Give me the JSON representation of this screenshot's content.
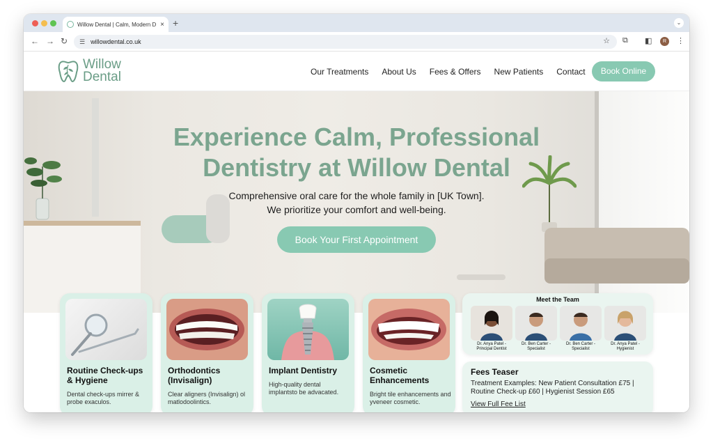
{
  "browser": {
    "tab_title": "Willow Dental | Calm, Modern D",
    "new_tab": "+",
    "close_tab": "×",
    "url": "willowdental.co.uk",
    "profile_initial": "R"
  },
  "site": {
    "logo_line1": "Willow",
    "logo_line2": "Dental",
    "nav": [
      "Our Treatments",
      "About Us",
      "Fees & Offers",
      "New Patients",
      "Contact"
    ],
    "book_online": "Book Online"
  },
  "hero": {
    "title_line1": "Experience Calm, Professional",
    "title_line2": "Dentistry at Willow Dental",
    "subtitle_line1": "Comprehensive oral care for the whole family in [UK Town].",
    "subtitle_line2": "We prioritize your comfort and well-being.",
    "cta": "Book Your First Appointment"
  },
  "cards": [
    {
      "title": "Routine Check-ups & Hygiene",
      "desc": "Dental check-ups mirrer & probe exaculos."
    },
    {
      "title": "Orthodontics (Invisalign)",
      "desc": "Clear aligners (Invisalign) ol matlodoolintics."
    },
    {
      "title": "Implant Dentistry",
      "desc": "High-quality dental implantsto be advacated."
    },
    {
      "title": "Cosmetic Enhancements",
      "desc": "Bright tile enhancements and yveneer cosmetic."
    }
  ],
  "team": {
    "title": "Meet the Team",
    "members": [
      {
        "name": "Dr. Anya Patel - Principal Dentist"
      },
      {
        "name": "Dr. Ben Carter - Specialist"
      },
      {
        "name": "Dr. Ben Carter - Specialist"
      },
      {
        "name": "Dr. Anya Patel - Hygienist"
      }
    ]
  },
  "fees": {
    "title": "Fees Teaser",
    "text": "Treatment Examples: New Patient Consultation £75  |  Routine Check-up £60  |  Hygienist Session £65",
    "link": "View Full Fee List"
  },
  "colors": {
    "accent": "#88c9b2",
    "heading": "#7ba58f",
    "card_bg": "#daf0e7"
  }
}
